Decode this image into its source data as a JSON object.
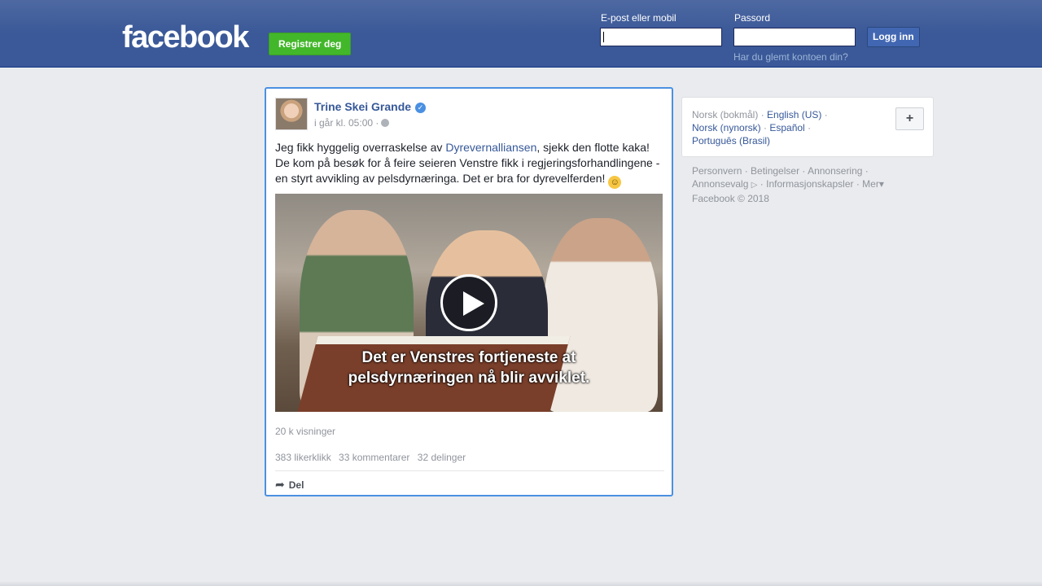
{
  "header": {
    "logo": "facebook",
    "register_label": "Registrer deg",
    "email_label": "E-post eller mobil",
    "password_label": "Passord",
    "login_label": "Logg inn",
    "forgot_label": "Har du glemt kontoen din?"
  },
  "post": {
    "author": "Trine Skei Grande",
    "verified_mark": "✓",
    "time": "i går kl. 05:00 ·",
    "text_before": "Jeg fikk hyggelig overraskelse av ",
    "text_link": "Dyrevernalliansen",
    "text_after": ", sjekk den flotte kaka! De kom på besøk for å feire seieren Venstre fikk i regjeringsforhandlingene - en styrt avvikling av pelsdyrnæringa. Det er bra for dyrevelferden! ",
    "emoji": "☺",
    "video_caption_line1": "Det er Venstres fortjeneste at",
    "video_caption_line2": "pelsdyrnæringen nå blir avviklet.",
    "views": "20 k visninger",
    "likes": "383 likerklikk",
    "comments": "33 kommentarer",
    "shares": "32 delinger",
    "share_icon": "➦",
    "share_label": "Del"
  },
  "sidebar": {
    "lang_current": "Norsk (bokmål)",
    "lang_english": "English (US)",
    "lang_nynorsk": "Norsk (nynorsk)",
    "lang_espanol": "Español",
    "lang_portugues": "Português (Brasil)",
    "plus_label": "+",
    "footer_line1": "Personvern · Betingelser · Annonsering ·",
    "footer_annonsevalg": "Annonsevalg",
    "footer_adchoice_icon": "▷",
    "footer_line2_rest": "· Informasjonskapsler · Mer",
    "footer_more_caret": "▾",
    "copyright": "Facebook © 2018"
  }
}
